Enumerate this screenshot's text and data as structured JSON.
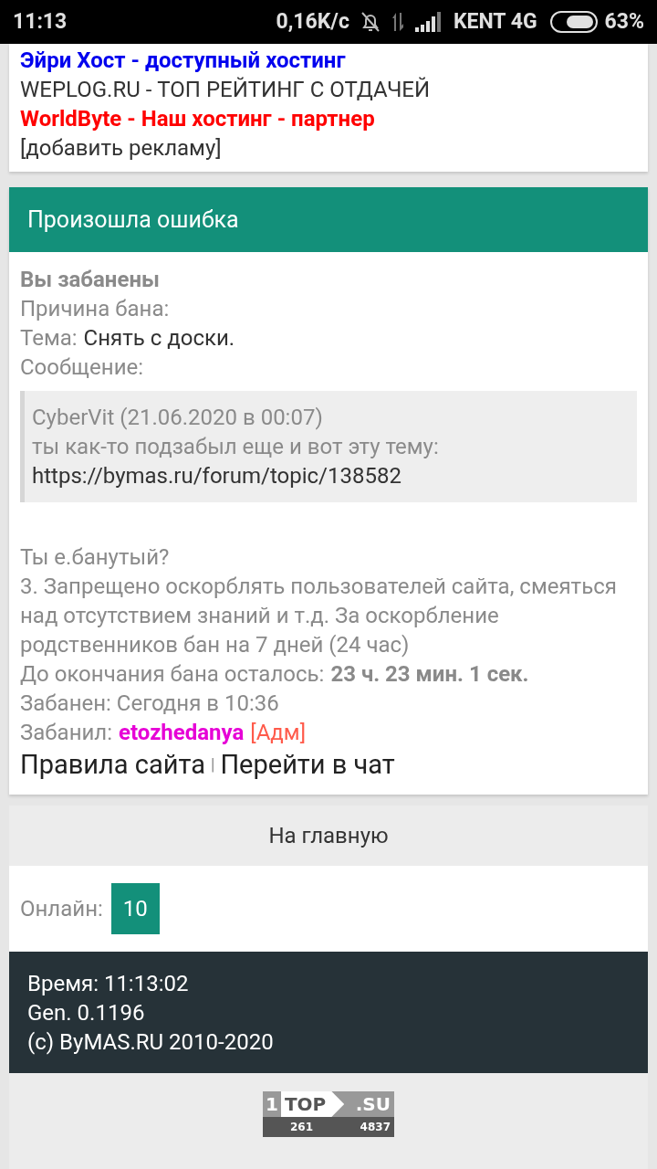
{
  "status_bar": {
    "time": "11:13",
    "network_speed": "0,16K/c",
    "carrier": "KENT 4G",
    "battery": "63%"
  },
  "ads": [
    {
      "text": "Эйри Хост - доступный хостинг",
      "kind": "highlight",
      "color": "#0000ee"
    },
    {
      "text": "WEPLOG.RU - ТОП РЕЙТИНГ С ОТДАЧЕЙ",
      "kind": "plain",
      "color": "#333333"
    },
    {
      "text": "WorldByte - Наш хостинг - партнер",
      "kind": "highlight",
      "color": "#ff0000"
    },
    {
      "text": "[добавить рекламу]",
      "kind": "plain",
      "color": "#333333"
    }
  ],
  "error": {
    "title": "Произошла ошибка",
    "heading": "Вы забанены",
    "reason_label": "Причина бана:",
    "topic_label": "Тема:",
    "topic_value": "Снять с доски.",
    "message_label": "Сообщение:",
    "quote": {
      "author_line": "CyberVit (21.06.2020 в 00:07)",
      "text": "ты как-то подзабыл еще и вот эту тему:",
      "link": "https://bymas.ru/forum/topic/138582"
    },
    "ban_question": "Ты е.банутый?",
    "rule_text": "3. Запрещено оскорблять пользователей сайта, смеяться над отсутствием знаний и т.д. За оскорбление родственников бан на 7 дней (24 час)",
    "remaining_label": "До окончания бана осталось:",
    "remaining_value": "23 ч. 23 мин. 1 сек.",
    "banned_at": "Забанен: Сегодня в 10:36",
    "banned_by_label": "Забанил:",
    "admin_name": "etozhedanya",
    "admin_role": "[Адм]",
    "links": [
      "Правила сайта",
      "Перейти в чат"
    ],
    "separator": "|"
  },
  "home_button": "На главную",
  "online_label": "Онлайн:",
  "online_count": "10",
  "footer": [
    "Время: 11:13:02",
    "Gen. 0.1196",
    "(c) ByMAS.RU 2010-2020"
  ],
  "counter": {
    "rank": "1",
    "top": "TOP",
    "domain": ".SU",
    "hits": "261",
    "hosts": "4837"
  }
}
